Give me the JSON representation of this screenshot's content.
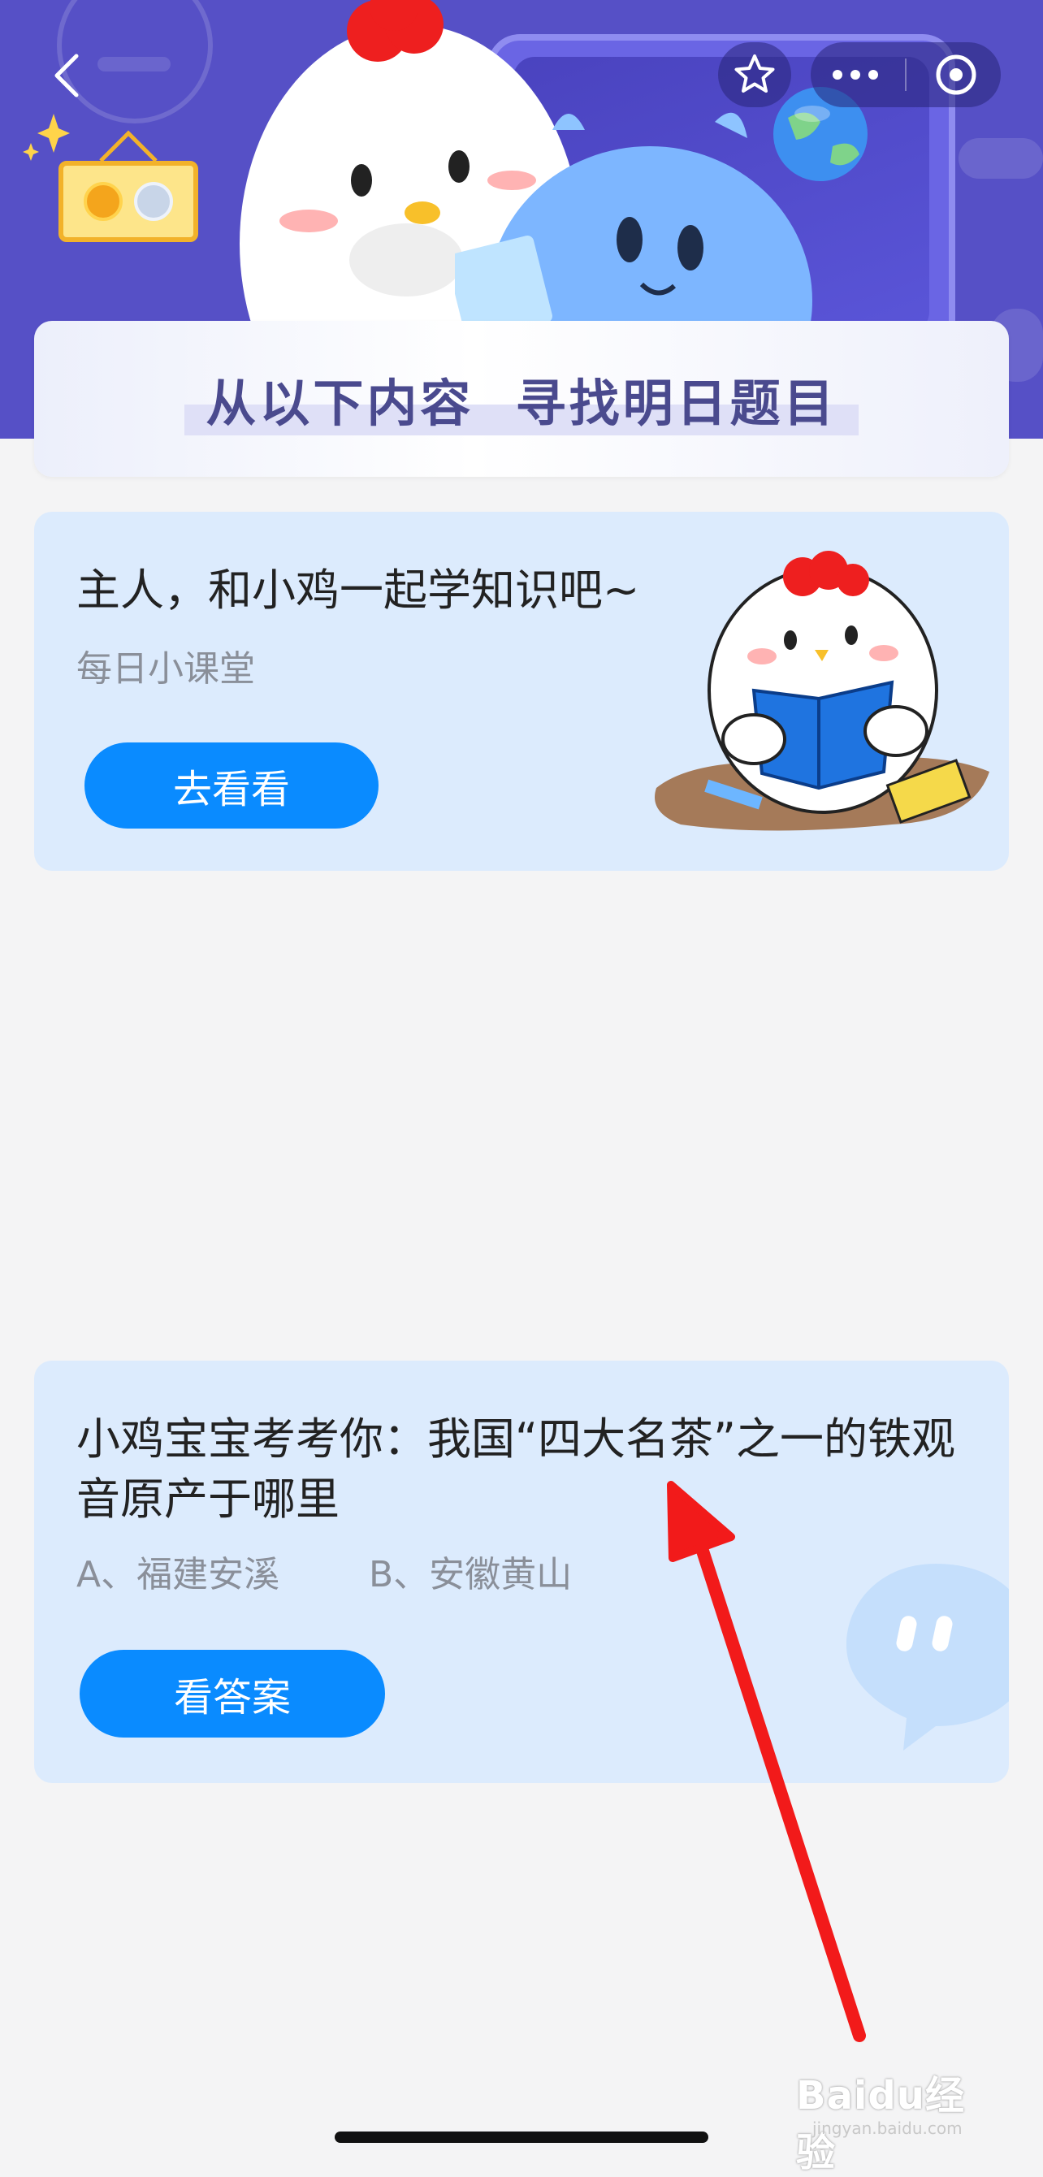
{
  "header": {
    "back_icon": "chevron-left-icon",
    "favorite_icon": "star-icon",
    "more_icon": "more-dots-icon",
    "close_icon": "target-circle-icon",
    "colors": {
      "background": "#5650c6",
      "panel": "#6a65e4"
    }
  },
  "banner": {
    "title": "从以下内容  寻找明日题目"
  },
  "card1": {
    "title": "主人，和小鸡一起学知识吧~",
    "subtitle": "每日小课堂",
    "button_label": "去看看"
  },
  "card2": {
    "question": "小鸡宝宝考考你：我国“四大名茶”之一的铁观音原产于哪里",
    "option_a": "A、福建安溪",
    "option_b": "B、安徽黄山",
    "button_label": "看答案"
  },
  "colors": {
    "card_bg": "#dcebfd",
    "button_blue": "#0a8bff",
    "annotation_arrow": "#f21a1a"
  },
  "watermark": {
    "brand": "Baidu经验",
    "url": "jingyan.baidu.com"
  }
}
